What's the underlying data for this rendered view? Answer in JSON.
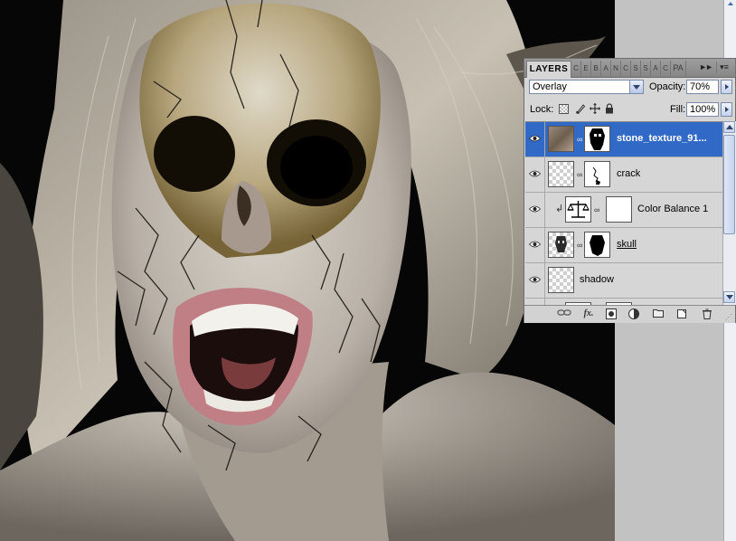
{
  "layers_panel": {
    "active_tab": "LAYERS",
    "other_tabs": [
      "C",
      "E",
      "B",
      "A",
      "N",
      "C",
      "S",
      "S",
      "A",
      "C"
    ],
    "last_tab": "PA",
    "collapse_glyph": "►►",
    "menu_glyph": "▾≡",
    "blend_mode": "Overlay",
    "opacity_label": "Opacity:",
    "opacity_value": "70%",
    "lock_label": "Lock:",
    "fill_label": "Fill:",
    "fill_value": "100%",
    "layers": [
      {
        "name": "stone_texture_91...",
        "visible": true,
        "selected": true,
        "thumb": "stone-texture",
        "mask": "mask-skull-shape",
        "linked": true
      },
      {
        "name": "crack",
        "visible": true,
        "selected": false,
        "thumb": "transparent",
        "mask": "mask-crack",
        "linked": true
      },
      {
        "name": "Color Balance 1",
        "visible": true,
        "selected": false,
        "thumb": "adjustment-balance-icon",
        "mask": "mask-white",
        "linked": true,
        "clipped": true
      },
      {
        "name": "skull",
        "visible": true,
        "selected": false,
        "thumb": "skull-image",
        "mask": "mask-skull",
        "linked": true,
        "underlined": true
      },
      {
        "name": "shadow",
        "visible": true,
        "selected": false,
        "thumb": "transparent"
      }
    ],
    "bottom_icons": [
      "link-layers-icon",
      "fx-icon",
      "add-mask-icon",
      "adjustment-layer-icon",
      "new-group-icon",
      "new-layer-icon",
      "trash-icon"
    ],
    "fx_text": "fx."
  },
  "colors": {
    "selected_row": "#3169c6",
    "panel_bg": "#d6d6d6",
    "gutter": "#c2c2c2"
  }
}
